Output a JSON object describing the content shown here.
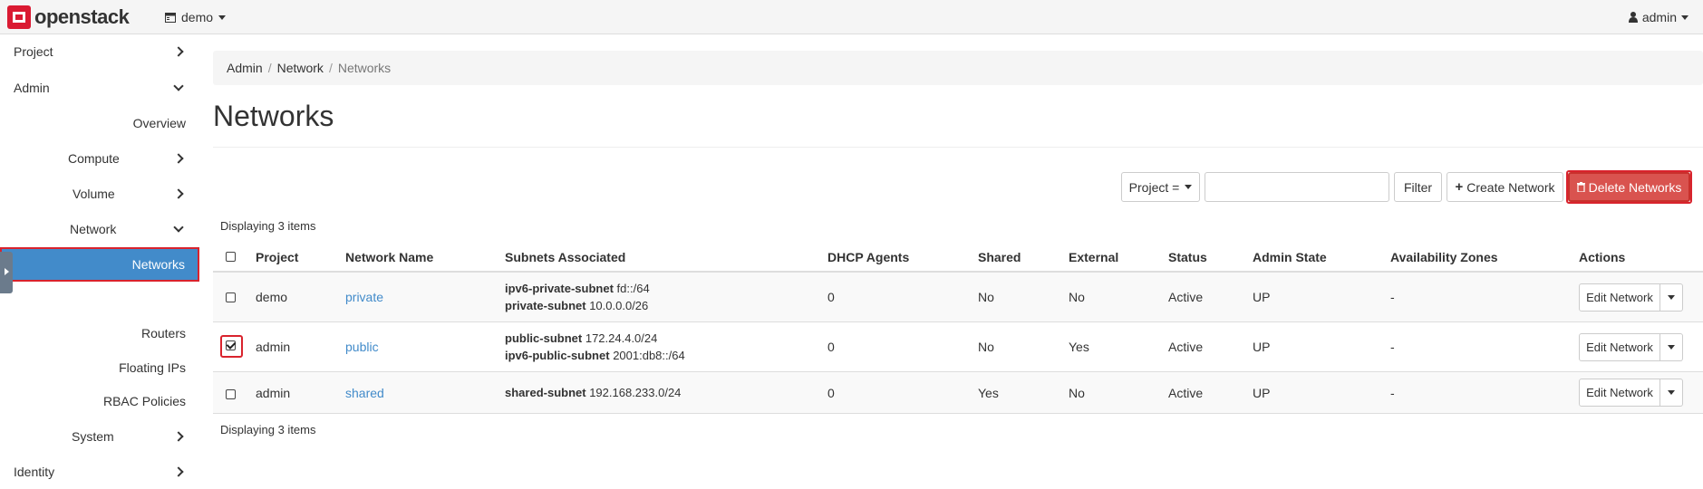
{
  "topbar": {
    "logo_text": "openstack",
    "project": "demo",
    "user": "admin"
  },
  "sidebar": {
    "items": [
      {
        "label": "Project",
        "chevron": "right"
      },
      {
        "label": "Admin",
        "chevron": "down"
      },
      {
        "label": "Overview"
      },
      {
        "label": "Compute",
        "chevron": "right"
      },
      {
        "label": "Volume",
        "chevron": "right"
      },
      {
        "label": "Network",
        "chevron": "down"
      },
      {
        "label": "Networks",
        "active": true
      },
      {
        "label": "Routers"
      },
      {
        "label": "Floating IPs"
      },
      {
        "label": "RBAC Policies"
      },
      {
        "label": "System",
        "chevron": "right"
      },
      {
        "label": "Identity",
        "chevron": "right"
      }
    ]
  },
  "breadcrumb": [
    "Admin",
    "Network",
    "Networks"
  ],
  "page_title": "Networks",
  "toolbar": {
    "filter_field": "Project =",
    "filter_value": "",
    "filter_button": "Filter",
    "create_button": "Create Network",
    "delete_button": "Delete Networks"
  },
  "display_count": "Displaying 3 items",
  "table": {
    "headers": [
      "Project",
      "Network Name",
      "Subnets Associated",
      "DHCP Agents",
      "Shared",
      "External",
      "Status",
      "Admin State",
      "Availability Zones",
      "Actions"
    ],
    "rows": [
      {
        "checked": false,
        "project": "demo",
        "name": "private",
        "subnets": [
          {
            "name": "ipv6-private-subnet",
            "cidr": "fd::/64"
          },
          {
            "name": "private-subnet",
            "cidr": "10.0.0.0/26"
          }
        ],
        "dhcp_agents": "0",
        "shared": "No",
        "external": "No",
        "status": "Active",
        "admin_state": "UP",
        "zones": "-",
        "action": "Edit Network"
      },
      {
        "checked": true,
        "project": "admin",
        "name": "public",
        "subnets": [
          {
            "name": "public-subnet",
            "cidr": "172.24.4.0/24"
          },
          {
            "name": "ipv6-public-subnet",
            "cidr": "2001:db8::/64"
          }
        ],
        "dhcp_agents": "0",
        "shared": "No",
        "external": "Yes",
        "status": "Active",
        "admin_state": "UP",
        "zones": "-",
        "action": "Edit Network"
      },
      {
        "checked": false,
        "project": "admin",
        "name": "shared",
        "subnets": [
          {
            "name": "shared-subnet",
            "cidr": "192.168.233.0/24"
          }
        ],
        "dhcp_agents": "0",
        "shared": "Yes",
        "external": "No",
        "status": "Active",
        "admin_state": "UP",
        "zones": "-",
        "action": "Edit Network"
      }
    ]
  },
  "colors": {
    "active_nav": "#428bca",
    "danger": "#d9534f",
    "link": "#428bca",
    "highlight_outline": "#d9232d"
  }
}
